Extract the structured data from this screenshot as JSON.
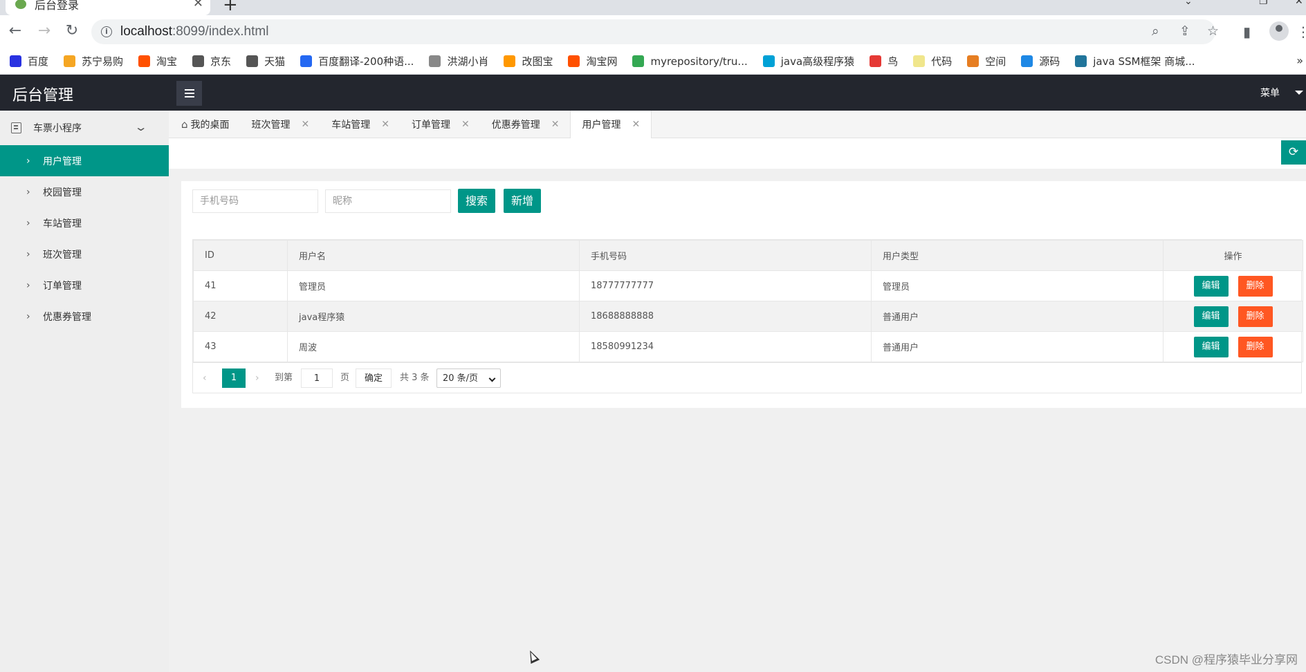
{
  "browser": {
    "tab_title": "后台登录",
    "url_host": "localhost",
    "url_rest": ":8099/index.html",
    "bookmarks": [
      {
        "label": "百度",
        "color": "#2932e1"
      },
      {
        "label": "苏宁易购",
        "color": "#f5a623"
      },
      {
        "label": "淘宝",
        "color": "#ff5000"
      },
      {
        "label": "京东",
        "color": "#555555"
      },
      {
        "label": "天猫",
        "color": "#555555"
      },
      {
        "label": "百度翻译-200种语...",
        "color": "#2468f2"
      },
      {
        "label": "洪湖小肖",
        "color": "#888888"
      },
      {
        "label": "改图宝",
        "color": "#ff9800"
      },
      {
        "label": "淘宝网",
        "color": "#ff5000"
      },
      {
        "label": "myrepository/tru...",
        "color": "#34a853"
      },
      {
        "label": "java高级程序猿",
        "color": "#00a1d6"
      },
      {
        "label": "鸟",
        "color": "#e53935"
      },
      {
        "label": "代码",
        "color": "#f0e68c"
      },
      {
        "label": "空间",
        "color": "#e67e22"
      },
      {
        "label": "源码",
        "color": "#1e88e5"
      },
      {
        "label": "java SSM框架 商城...",
        "color": "#21759b"
      }
    ],
    "more": "»"
  },
  "header": {
    "logo": "后台管理",
    "menu_label": "菜单"
  },
  "sidebar": {
    "group": "车票小程序",
    "items": [
      {
        "label": "用户管理",
        "active": true
      },
      {
        "label": "校园管理",
        "active": false
      },
      {
        "label": "车站管理",
        "active": false
      },
      {
        "label": "班次管理",
        "active": false
      },
      {
        "label": "订单管理",
        "active": false
      },
      {
        "label": "优惠券管理",
        "active": false
      }
    ]
  },
  "tabs": [
    {
      "label": "我的桌面",
      "closable": false
    },
    {
      "label": "班次管理",
      "closable": true
    },
    {
      "label": "车站管理",
      "closable": true
    },
    {
      "label": "订单管理",
      "closable": true
    },
    {
      "label": "优惠券管理",
      "closable": true
    },
    {
      "label": "用户管理",
      "closable": true,
      "active": true
    }
  ],
  "search": {
    "phone_placeholder": "手机号码",
    "nickname_placeholder": "昵称",
    "search_label": "搜索",
    "add_label": "新增"
  },
  "table": {
    "columns": [
      "ID",
      "用户名",
      "手机号码",
      "用户类型",
      "操作"
    ],
    "rows": [
      {
        "id": "41",
        "username": "管理员",
        "phone": "18777777777",
        "type": "管理员"
      },
      {
        "id": "42",
        "username": "java程序猿",
        "phone": "18688888888",
        "type": "普通用户"
      },
      {
        "id": "43",
        "username": "周波",
        "phone": "18580991234",
        "type": "普通用户"
      }
    ],
    "edit_label": "编辑",
    "delete_label": "删除"
  },
  "pager": {
    "prev": "‹",
    "current": "1",
    "next": "›",
    "goto_label": "到第",
    "goto_value": "1",
    "page_unit": "页",
    "confirm_label": "确定",
    "total_label": "共 3 条",
    "page_size": "20 条/页"
  },
  "watermark": "CSDN @程序猿毕业分享网"
}
